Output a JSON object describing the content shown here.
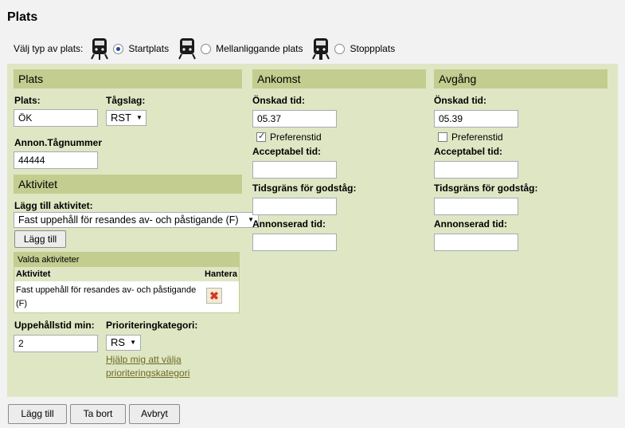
{
  "page": {
    "title": "Plats"
  },
  "type_row": {
    "label": "Välj typ av plats:",
    "options": [
      {
        "label": "Startplats",
        "selected": true,
        "icon": "train-icon"
      },
      {
        "label": "Mellanliggande plats",
        "selected": false,
        "icon": "train-icon"
      },
      {
        "label": "Stoppplats",
        "selected": false,
        "icon": "train-icon"
      }
    ]
  },
  "plats": {
    "header": "Plats",
    "plats_label": "Plats:",
    "plats_value": "ÖK",
    "tagslag_label": "Tågslag:",
    "tagslag_value": "RST",
    "tagnummer_label": "Annon.Tågnummer",
    "tagnummer_value": "44444"
  },
  "aktivitet": {
    "header": "Aktivitet",
    "add_label": "Lägg till aktivitet:",
    "select_value": "Fast uppehåll för resandes av- och påstigande (F)",
    "add_button": "Lägg till",
    "valda_header": "Valda aktiviteter",
    "col_aktivitet": "Aktivitet",
    "col_hantera": "Hantera",
    "rows": [
      {
        "text_line1": "Fast uppehåll för resandes av- och påstigande",
        "text_line2": "(F)"
      }
    ],
    "uppehall_label": "Uppehållstid min:",
    "uppehall_value": "2",
    "prio_label": "Prioriteringkategori:",
    "prio_value": "RS",
    "help_link_line1": "Hjälp mig att välja",
    "help_link_line2": "prioriteringskategori"
  },
  "ankomst": {
    "header": "Ankomst",
    "onskad_label": "Önskad tid:",
    "onskad_value": "05.37",
    "preferens_label": "Preferenstid",
    "preferens_checked": true,
    "acceptabel_label": "Acceptabel tid:",
    "acceptabel_value": "",
    "tidsgrans_label": "Tidsgräns för godståg:",
    "tidsgrans_value": "",
    "annonserad_label": "Annonserad tid:",
    "annonserad_value": ""
  },
  "avgang": {
    "header": "Avgång",
    "onskad_label": "Önskad tid:",
    "onskad_value": "05.39",
    "preferens_label": "Preferenstid",
    "preferens_checked": false,
    "acceptabel_label": "Acceptabel tid:",
    "acceptabel_value": "",
    "tidsgrans_label": "Tidsgräns för godståg:",
    "tidsgrans_value": "",
    "annonserad_label": "Annonserad tid:",
    "annonserad_value": ""
  },
  "footer": {
    "add_button": "Lägg till",
    "remove_button": "Ta bort",
    "cancel_button": "Avbryt"
  },
  "colors": {
    "panel": "#dfe6c4",
    "header": "#c3cd8f",
    "link": "#6b6b23"
  }
}
